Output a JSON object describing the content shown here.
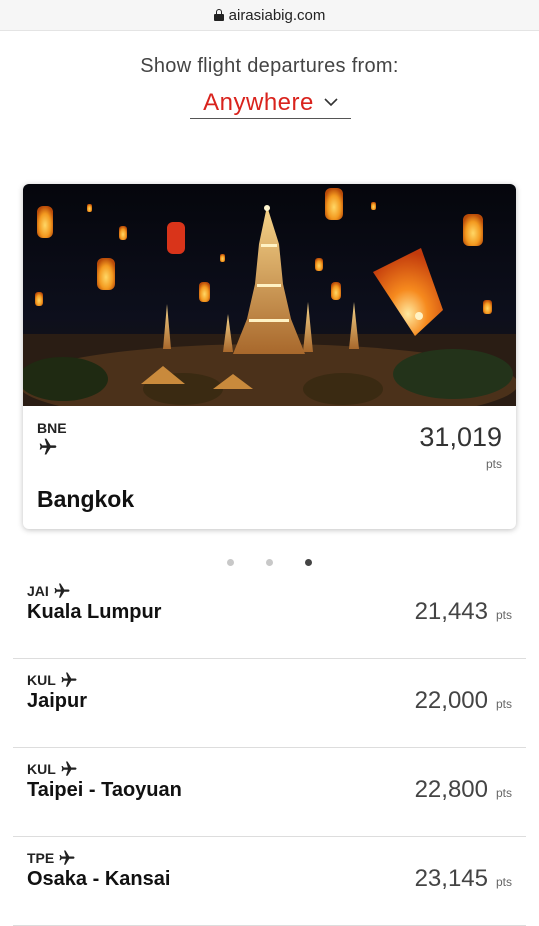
{
  "browser": {
    "url": "airasiabig.com"
  },
  "filter": {
    "heading": "Show flight departures from:",
    "origin": "Anywhere"
  },
  "featured": {
    "origin_code": "BNE",
    "points": "31,019",
    "points_label": "pts",
    "destination": "Bangkok",
    "image_icon": "temple-lanterns-photo"
  },
  "carousel": {
    "total": 3,
    "active_index": 3
  },
  "deals": [
    {
      "origin_code": "JAI",
      "destination": "Kuala Lumpur",
      "points": "21,443",
      "unit": "pts"
    },
    {
      "origin_code": "KUL",
      "destination": "Jaipur",
      "points": "22,000",
      "unit": "pts"
    },
    {
      "origin_code": "KUL",
      "destination": "Taipei - Taoyuan",
      "points": "22,800",
      "unit": "pts"
    },
    {
      "origin_code": "TPE",
      "destination": "Osaka - Kansai",
      "points": "23,145",
      "unit": "pts"
    }
  ],
  "colors": {
    "accent": "#d9231d",
    "text": "#222222",
    "divider": "#dddddd"
  }
}
